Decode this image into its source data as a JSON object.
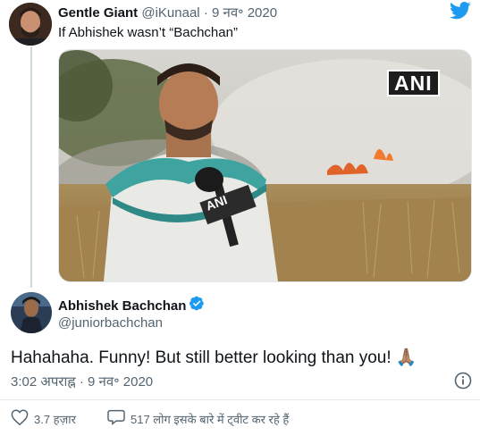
{
  "quoted_tweet": {
    "name": "Gentle Giant",
    "handle": "@iKunaal",
    "separator": "·",
    "date": "9 नव॰ 2020",
    "text": "If Abhishek wasn’t “Bachchan”",
    "media_badge": "ANI",
    "mic_label": "ANI"
  },
  "reply_tweet": {
    "name": "Abhishek Bachchan",
    "handle": "@juniorbachchan",
    "text": "Hahahaha. Funny! But still better looking than you! 🙏🏽",
    "timestamp": "3:02 अपराह्न · 9 नव॰ 2020"
  },
  "actions": {
    "likes": "3.7 हज़ार",
    "replies_text": "517 लोग इसके बारे में ट्वीट कर रहे हैं"
  },
  "colors": {
    "twitter_blue": "#1d9bf0",
    "verified_blue": "#1d9bf0",
    "like_gray": "#536471"
  },
  "icons": [
    "twitter-logo-icon",
    "verified-badge-icon",
    "info-icon",
    "heart-icon",
    "comment-icon"
  ]
}
